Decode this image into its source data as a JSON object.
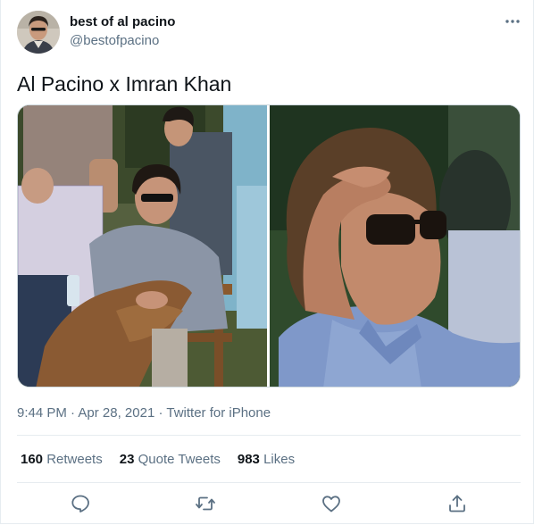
{
  "tweet": {
    "author": {
      "display_name": "best of al pacino",
      "handle": "@bestofpacino",
      "avatar_icon": "profile-photo"
    },
    "text": "Al Pacino x Imran Khan",
    "media": [
      {
        "alt": "Al Pacino seated in a director's chair wearing sunglasses"
      },
      {
        "alt": "Imran Khan in sunglasses with hand on forehead"
      }
    ],
    "meta": {
      "time": "9:44 PM",
      "separator": " · ",
      "date": "Apr 28, 2021",
      "source": "Twitter for iPhone"
    },
    "stats": {
      "retweets_count": "160",
      "retweets_label": " Retweets",
      "quotes_count": "23",
      "quotes_label": " Quote Tweets",
      "likes_count": "983",
      "likes_label": " Likes"
    },
    "actions": [
      "reply-icon",
      "retweet-icon",
      "like-icon",
      "share-icon"
    ],
    "colors": {
      "text": "#0f1419",
      "secondary": "#5b7083",
      "border": "#e6ecf0",
      "icon": "#5b7083"
    }
  }
}
